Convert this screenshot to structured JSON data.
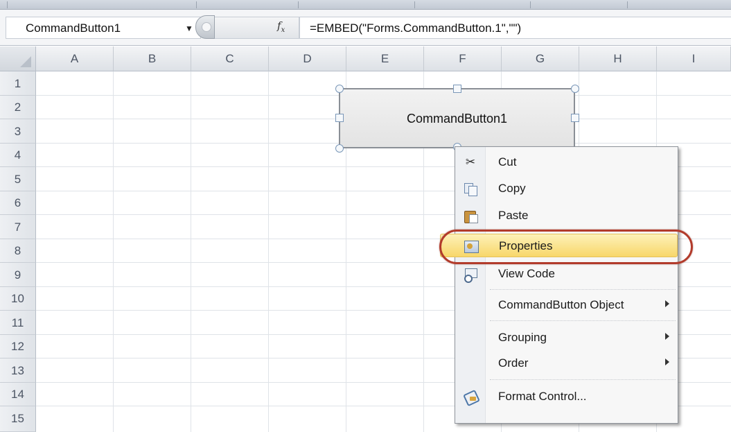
{
  "formula_bar": {
    "name_box": "CommandButton1",
    "fx_label": "fx",
    "formula": "=EMBED(\"Forms.CommandButton.1\",\"\")"
  },
  "columns": [
    "A",
    "B",
    "C",
    "D",
    "E",
    "F",
    "G",
    "H",
    "I"
  ],
  "rows": [
    "1",
    "2",
    "3",
    "4",
    "5",
    "6",
    "7",
    "8",
    "9",
    "10",
    "11",
    "12",
    "13",
    "14",
    "15"
  ],
  "command_button": {
    "label": "CommandButton1"
  },
  "context_menu": {
    "items": [
      {
        "label": "Cut",
        "icon": "scissors-icon"
      },
      {
        "label": "Copy",
        "icon": "copy-icon"
      },
      {
        "label": "Paste",
        "icon": "paste-icon"
      },
      {
        "label": "Properties",
        "icon": "properties-icon",
        "highlighted": true
      },
      {
        "label": "View Code",
        "icon": "view-code-icon"
      },
      {
        "label": "CommandButton Object",
        "submenu": true
      },
      {
        "label": "Grouping",
        "submenu": true
      },
      {
        "label": "Order",
        "submenu": true
      },
      {
        "label": "Format Control...",
        "icon": "format-control-icon"
      }
    ]
  },
  "colors": {
    "highlight": "#f8d76a",
    "annotation_ring": "#b23b2b"
  }
}
